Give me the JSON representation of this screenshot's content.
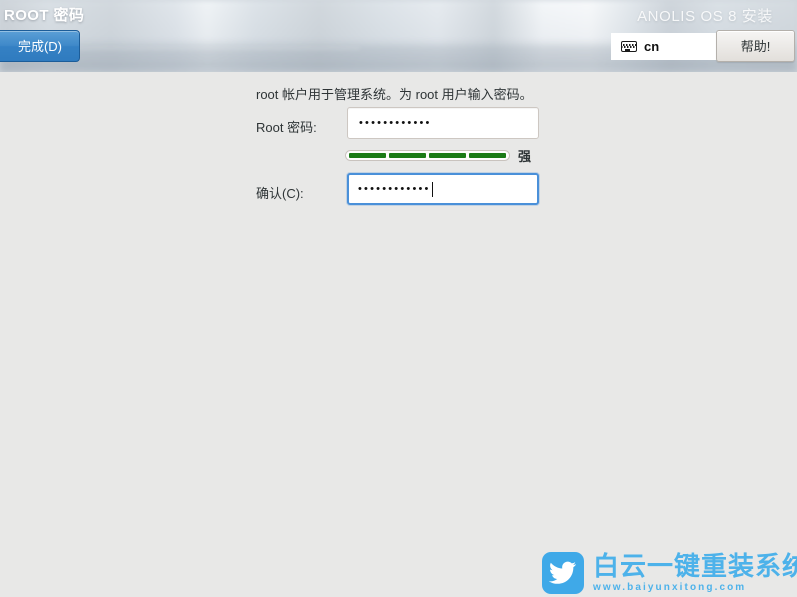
{
  "header": {
    "page_title": "ROOT 密码",
    "product_title": "ANOLIS OS 8 安装",
    "done_button": "完成(D)",
    "help_button": "帮助!",
    "keyboard_layout": "cn",
    "keyboard_icon": "keyboard-icon"
  },
  "main": {
    "description": "root 帐户用于管理系统。为 root 用户输入密码。",
    "root_password": {
      "label": "Root 密码:",
      "value": "••••••••••••",
      "placeholder": ""
    },
    "confirm_password": {
      "label": "确认(C):",
      "value": "••••••••••••",
      "placeholder": ""
    },
    "strength": {
      "label": "强",
      "segments_total": 4,
      "segments_filled": 4,
      "fill_color": "#1a7a16"
    }
  },
  "watermark": {
    "brand": "白云一键重装系统",
    "url": "www.baiyunxitong.com",
    "badge_icon": "bird-icon",
    "color": "#4db2ea"
  }
}
